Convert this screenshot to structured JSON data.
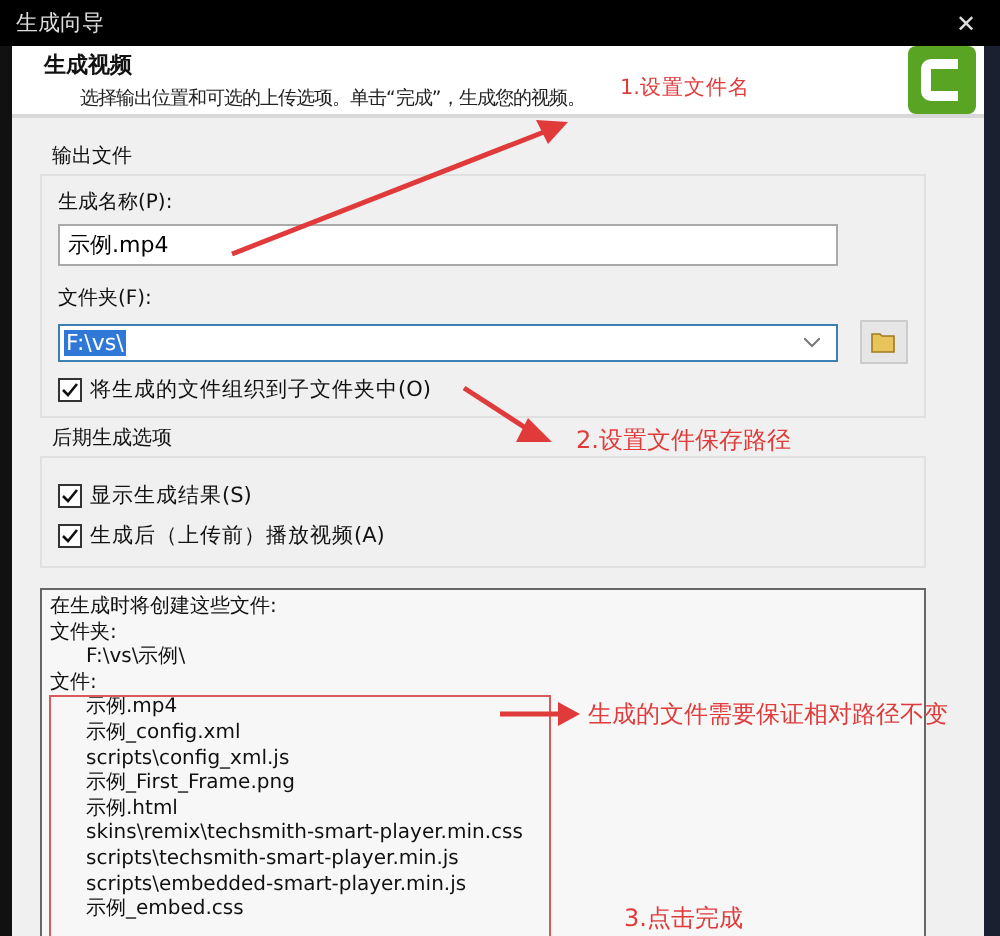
{
  "window": {
    "title": "生成向导",
    "close": "✕"
  },
  "header": {
    "title": "生成视频",
    "subtitle": "选择输出位置和可选的上传选项。单击“完成”，生成您的视频。"
  },
  "output_group": {
    "title": "输出文件",
    "name_label": "生成名称(P):",
    "name_value": "示例.mp4",
    "folder_label": "文件夹(F):",
    "folder_value": "F:\\vs\\",
    "folder_value_selected": true,
    "options": [
      {
        "label": "将生成的文件组织到子文件夹中(O)",
        "checked": true
      }
    ]
  },
  "post_group": {
    "title": "后期生成选项",
    "options": [
      {
        "label": "显示生成结果(S)",
        "checked": true
      },
      {
        "label": "生成后（上传前）播放视频(A)",
        "checked": true
      }
    ]
  },
  "file_list": {
    "lines": [
      {
        "text": "在生成时将创建这些文件:",
        "indent": false
      },
      {
        "text": "文件夹:",
        "indent": false
      },
      {
        "text": "F:\\vs\\示例\\",
        "indent": true
      },
      {
        "text": "文件:",
        "indent": false
      },
      {
        "text": "示例.mp4",
        "indent": true
      },
      {
        "text": "示例_config.xml",
        "indent": true
      },
      {
        "text": "scripts\\config_xml.js",
        "indent": true
      },
      {
        "text": "示例_First_Frame.png",
        "indent": true
      },
      {
        "text": "示例.html",
        "indent": true
      },
      {
        "text": "skins\\remix\\techsmith-smart-player.min.css",
        "indent": true
      },
      {
        "text": "scripts\\techsmith-smart-player.min.js",
        "indent": true
      },
      {
        "text": "scripts\\embedded-smart-player.min.js",
        "indent": true
      },
      {
        "text": "示例_embed.css",
        "indent": true
      }
    ]
  },
  "annotations": [
    {
      "text": "1.设置文件名"
    },
    {
      "text": "2.设置文件保存路径"
    },
    {
      "text": "生成的文件需要保证相对路径不变"
    },
    {
      "text": "3.点击完成"
    }
  ]
}
